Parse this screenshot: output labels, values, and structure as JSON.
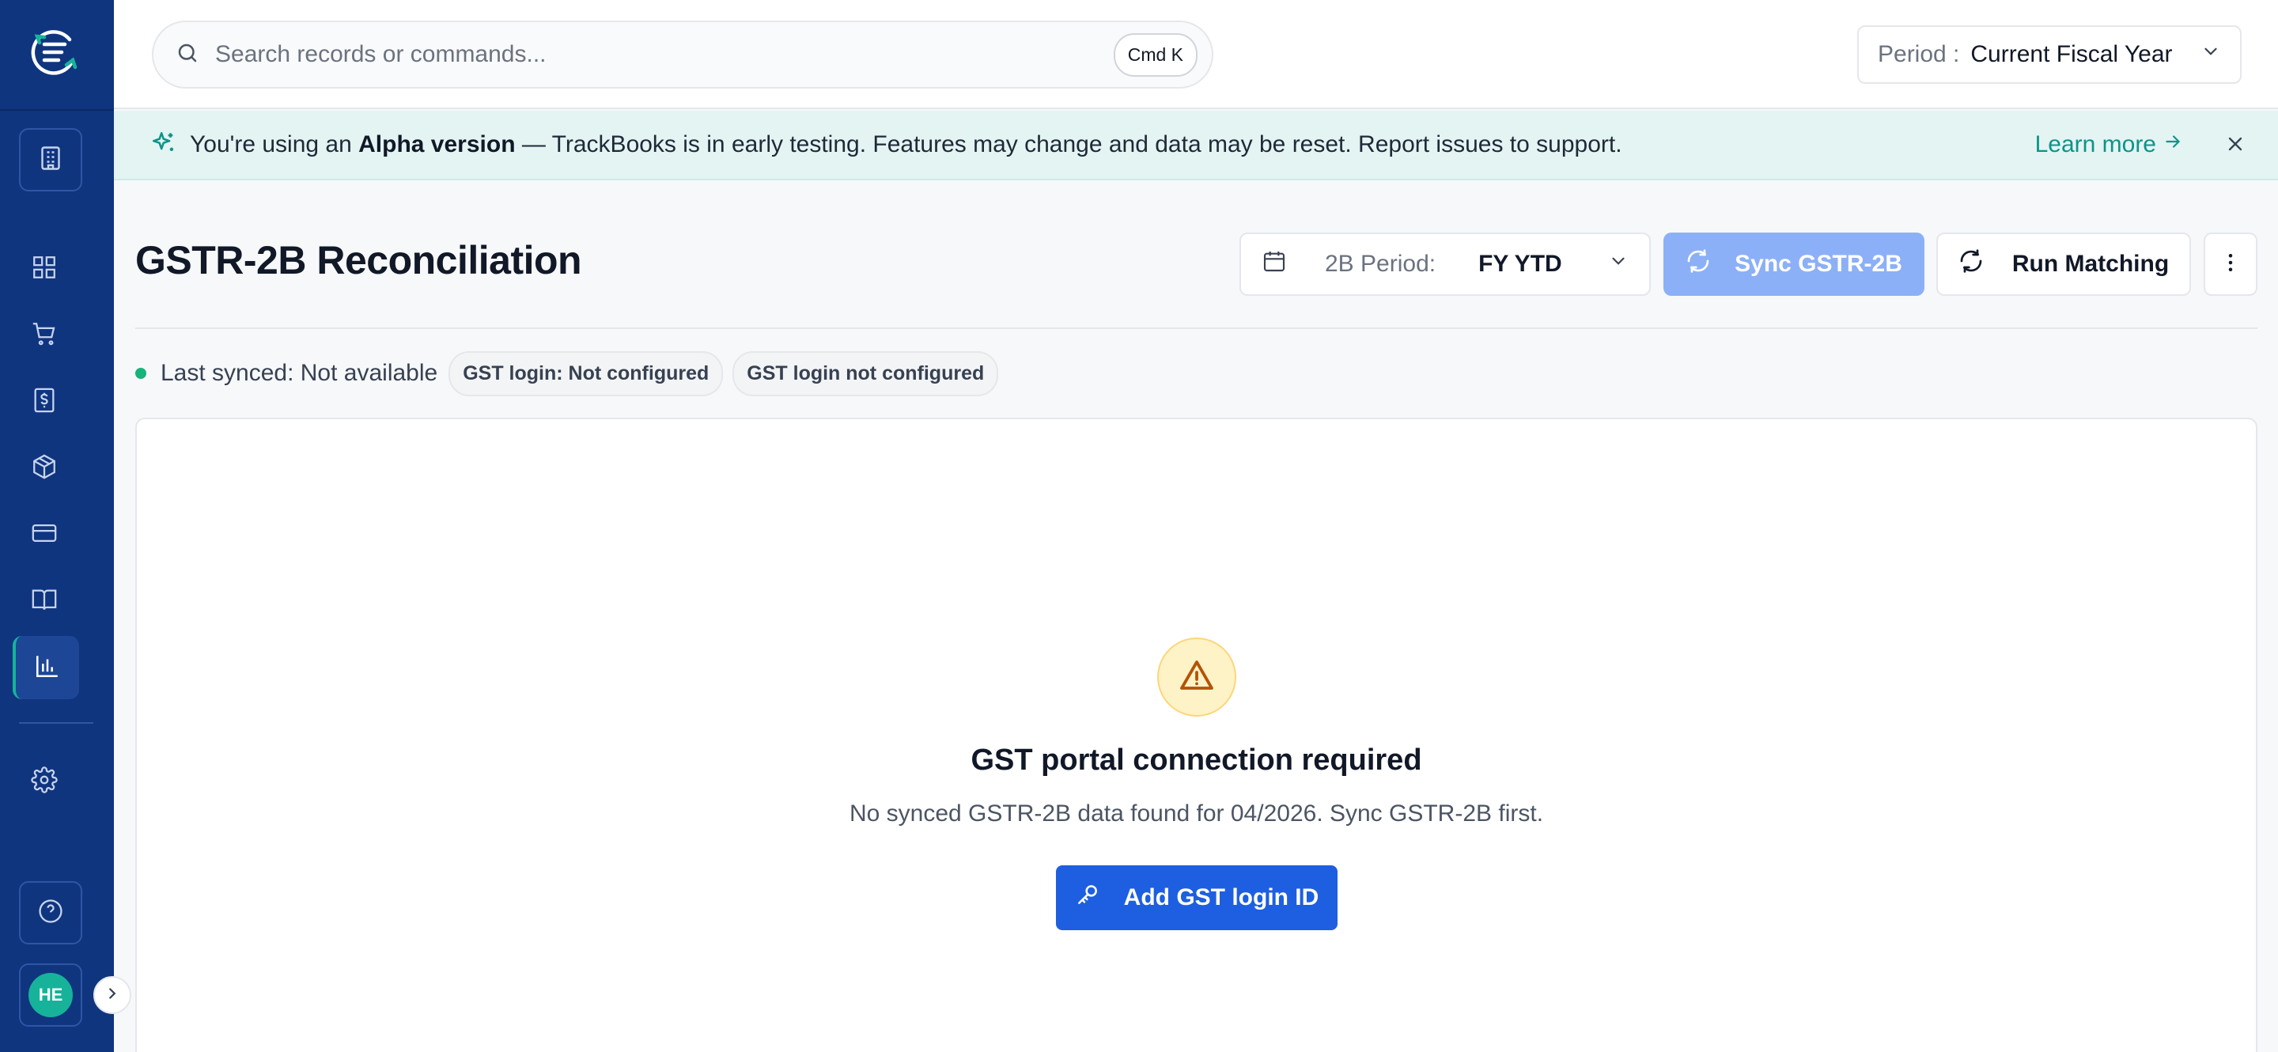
{
  "sidebar": {
    "logo_icon": "trackbooks-logo-icon",
    "items": [
      {
        "name": "building-icon"
      },
      {
        "name": "dashboard-grid-icon"
      },
      {
        "name": "shopping-cart-icon"
      },
      {
        "name": "invoice-dollar-icon"
      },
      {
        "name": "package-box-icon"
      },
      {
        "name": "credit-card-icon"
      },
      {
        "name": "book-open-icon"
      },
      {
        "name": "bar-chart-icon",
        "active": true
      },
      {
        "name": "settings-gear-icon"
      },
      {
        "name": "help-circle-icon"
      }
    ],
    "avatar_initials": "HE"
  },
  "topbar": {
    "search_placeholder": "Search records or commands...",
    "shortcut": "Cmd K",
    "period_label": "Period :",
    "period_value": "Current Fiscal Year"
  },
  "banner": {
    "prefix": "You're using an",
    "highlight": "Alpha version",
    "suffix": "— TrackBooks is in early testing. Features may change and data may be reset. Report issues to support.",
    "link": "Learn more"
  },
  "header": {
    "title": "GSTR-2B Reconciliation",
    "period_label": "2B Period:",
    "period_value": "FY YTD",
    "sync_label": "Sync GSTR-2B",
    "run_label": "Run Matching"
  },
  "status": {
    "last_synced": "Last synced: Not available",
    "pills": [
      "GST login: Not configured",
      "GST login not configured"
    ]
  },
  "empty_state": {
    "title": "GST portal connection required",
    "description": "No synced GSTR-2B data found for 04/2026. Sync GSTR-2B first.",
    "button": "Add GST login ID"
  },
  "colors": {
    "sidebar_bg": "#10357f",
    "accent_teal": "#16b39a",
    "primary_blue": "#1d5fe0",
    "disabled_blue": "#8cb0f7",
    "warning_bg": "#fef3c7"
  }
}
